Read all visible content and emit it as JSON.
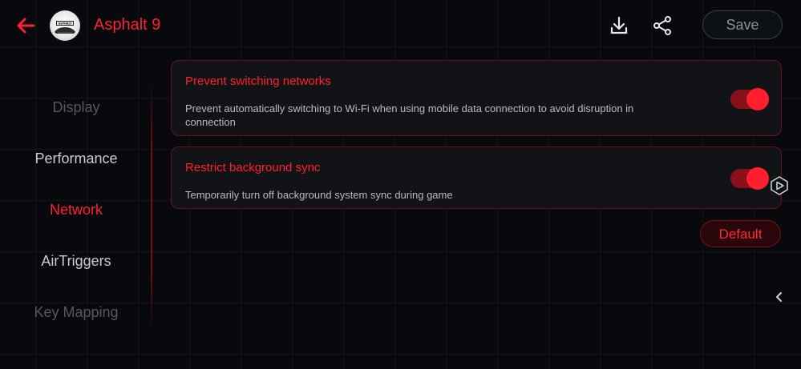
{
  "header": {
    "app_title": "Asphalt 9",
    "app_icon_text": "ASPHALT",
    "save_label": "Save",
    "accent_color": "#ff2130"
  },
  "side_nav": {
    "items": [
      {
        "label": "Display",
        "state": "dim"
      },
      {
        "label": "Performance",
        "state": "normal"
      },
      {
        "label": "Network",
        "state": "active"
      },
      {
        "label": "AirTriggers",
        "state": "normal"
      },
      {
        "label": "Key Mapping",
        "state": "dim"
      }
    ]
  },
  "settings": [
    {
      "title": "Prevent switching networks",
      "description": "Prevent automatically switching to Wi-Fi when using mobile data connection to avoid disruption in connection",
      "enabled": true
    },
    {
      "title": "Restrict background sync",
      "description": "Temporarily turn off background system sync during game",
      "enabled": true
    }
  ],
  "default_label": "Default",
  "icons": {
    "back": "arrow-left-icon",
    "download": "download-icon",
    "share": "share-icon",
    "floating": "play-icon",
    "collapse": "chevron-left-icon"
  }
}
